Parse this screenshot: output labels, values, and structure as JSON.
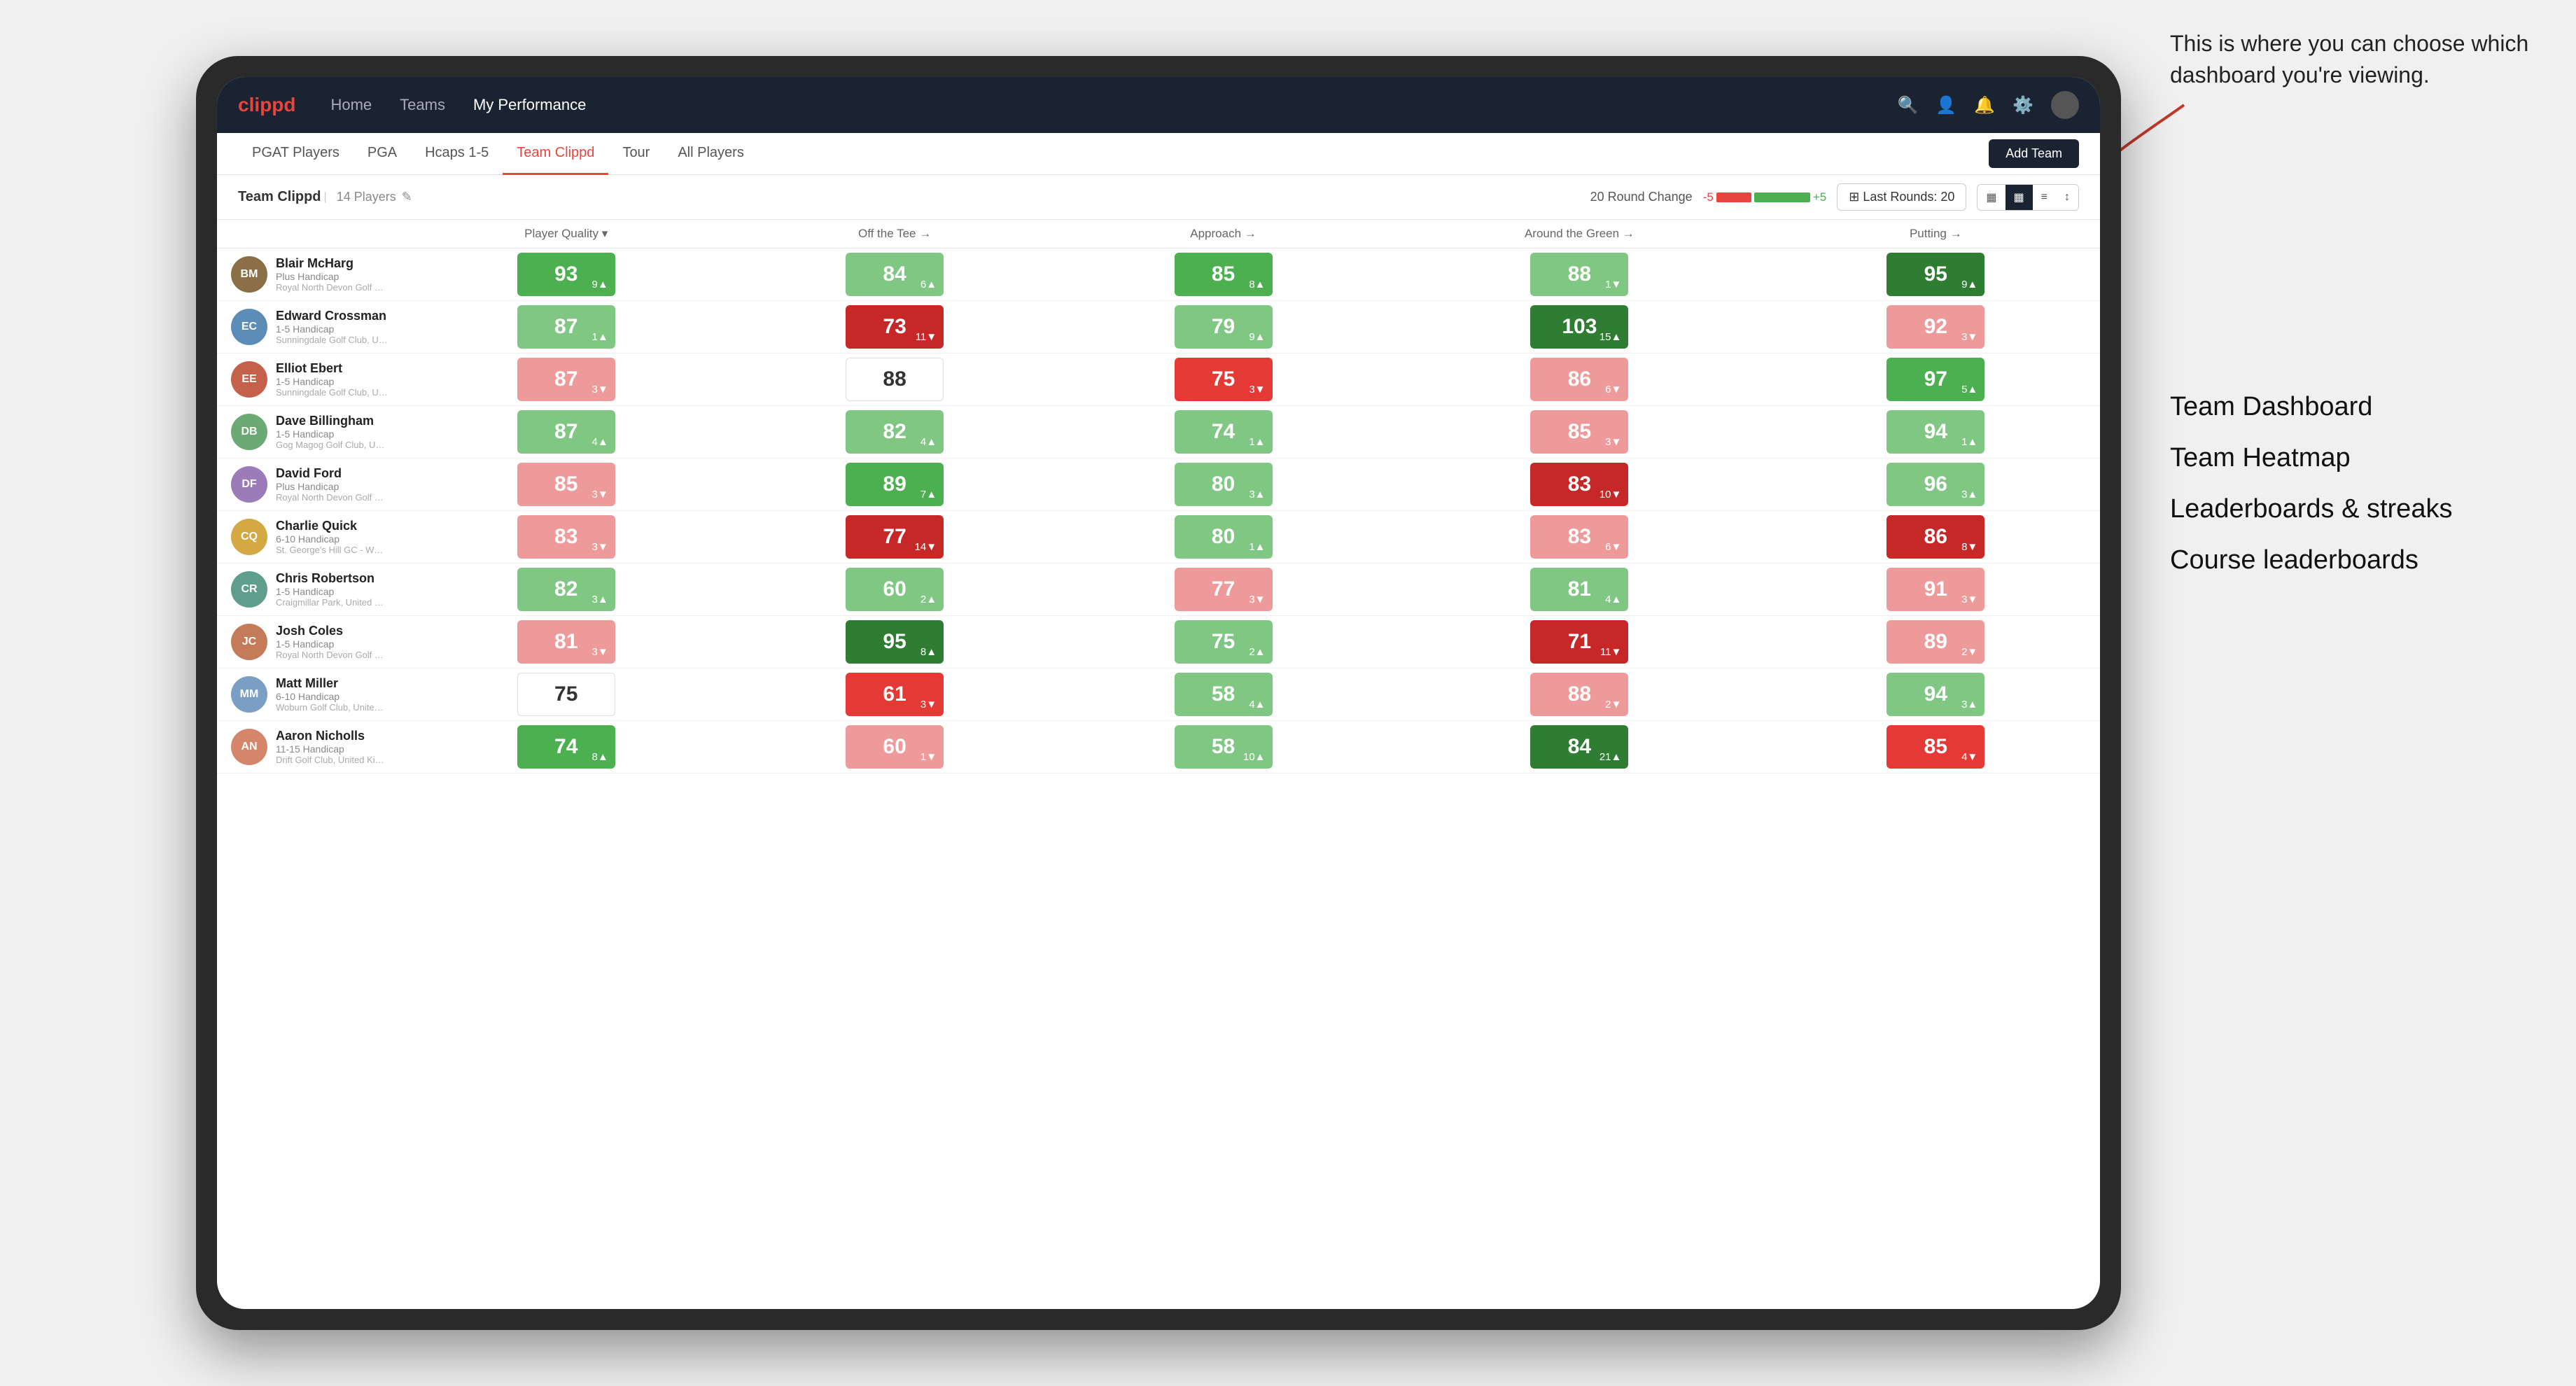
{
  "annotation": {
    "intro": "This is where you can choose which dashboard you're viewing.",
    "items": [
      "Team Dashboard",
      "Team Heatmap",
      "Leaderboards & streaks",
      "Course leaderboards"
    ]
  },
  "nav": {
    "logo": "clippd",
    "items": [
      "Home",
      "Teams",
      "My Performance"
    ],
    "active": "My Performance"
  },
  "subnav": {
    "items": [
      "PGAT Players",
      "PGA",
      "Hcaps 1-5",
      "Team Clippd",
      "Tour",
      "All Players"
    ],
    "active": "Team Clippd",
    "add_button": "Add Team"
  },
  "teambar": {
    "team_name": "Team Clippd",
    "player_count": "14 Players",
    "round_change_label": "20 Round Change",
    "neg_label": "-5",
    "pos_label": "+5",
    "last_rounds_label": "Last Rounds: 20"
  },
  "table": {
    "headers": [
      "Player Quality ↓",
      "Off the Tee →",
      "Approach →",
      "Around the Green →",
      "Putting →"
    ],
    "players": [
      {
        "name": "Blair McHarg",
        "handicap": "Plus Handicap",
        "club": "Royal North Devon Golf Club, United Kingdom",
        "scores": [
          {
            "val": "93",
            "delta": "9",
            "dir": "up",
            "color": "green-med"
          },
          {
            "val": "84",
            "delta": "6",
            "dir": "up",
            "color": "green-light"
          },
          {
            "val": "85",
            "delta": "8",
            "dir": "up",
            "color": "green-med"
          },
          {
            "val": "88",
            "delta": "1",
            "dir": "down",
            "color": "green-light"
          },
          {
            "val": "95",
            "delta": "9",
            "dir": "up",
            "color": "green-dark"
          }
        ]
      },
      {
        "name": "Edward Crossman",
        "handicap": "1-5 Handicap",
        "club": "Sunningdale Golf Club, United Kingdom",
        "scores": [
          {
            "val": "87",
            "delta": "1",
            "dir": "up",
            "color": "green-light"
          },
          {
            "val": "73",
            "delta": "11",
            "dir": "down",
            "color": "red-dark"
          },
          {
            "val": "79",
            "delta": "9",
            "dir": "up",
            "color": "green-light"
          },
          {
            "val": "103",
            "delta": "15",
            "dir": "up",
            "color": "green-dark"
          },
          {
            "val": "92",
            "delta": "3",
            "dir": "down",
            "color": "red-light"
          }
        ]
      },
      {
        "name": "Elliot Ebert",
        "handicap": "1-5 Handicap",
        "club": "Sunningdale Golf Club, United Kingdom",
        "scores": [
          {
            "val": "87",
            "delta": "3",
            "dir": "down",
            "color": "red-light"
          },
          {
            "val": "88",
            "delta": "",
            "dir": "",
            "color": "white-bg"
          },
          {
            "val": "75",
            "delta": "3",
            "dir": "down",
            "color": "red-med"
          },
          {
            "val": "86",
            "delta": "6",
            "dir": "down",
            "color": "red-light"
          },
          {
            "val": "97",
            "delta": "5",
            "dir": "up",
            "color": "green-med"
          }
        ]
      },
      {
        "name": "Dave Billingham",
        "handicap": "1-5 Handicap",
        "club": "Gog Magog Golf Club, United Kingdom",
        "scores": [
          {
            "val": "87",
            "delta": "4",
            "dir": "up",
            "color": "green-light"
          },
          {
            "val": "82",
            "delta": "4",
            "dir": "up",
            "color": "green-light"
          },
          {
            "val": "74",
            "delta": "1",
            "dir": "up",
            "color": "green-light"
          },
          {
            "val": "85",
            "delta": "3",
            "dir": "down",
            "color": "red-light"
          },
          {
            "val": "94",
            "delta": "1",
            "dir": "up",
            "color": "green-light"
          }
        ]
      },
      {
        "name": "David Ford",
        "handicap": "Plus Handicap",
        "club": "Royal North Devon Golf Club, United Kingdom",
        "scores": [
          {
            "val": "85",
            "delta": "3",
            "dir": "down",
            "color": "red-light"
          },
          {
            "val": "89",
            "delta": "7",
            "dir": "up",
            "color": "green-med"
          },
          {
            "val": "80",
            "delta": "3",
            "dir": "up",
            "color": "green-light"
          },
          {
            "val": "83",
            "delta": "10",
            "dir": "down",
            "color": "red-dark"
          },
          {
            "val": "96",
            "delta": "3",
            "dir": "up",
            "color": "green-light"
          }
        ]
      },
      {
        "name": "Charlie Quick",
        "handicap": "6-10 Handicap",
        "club": "St. George's Hill GC - Weybridge - Surrey, Uni...",
        "scores": [
          {
            "val": "83",
            "delta": "3",
            "dir": "down",
            "color": "red-light"
          },
          {
            "val": "77",
            "delta": "14",
            "dir": "down",
            "color": "red-dark"
          },
          {
            "val": "80",
            "delta": "1",
            "dir": "up",
            "color": "green-light"
          },
          {
            "val": "83",
            "delta": "6",
            "dir": "down",
            "color": "red-light"
          },
          {
            "val": "86",
            "delta": "8",
            "dir": "down",
            "color": "red-dark"
          }
        ]
      },
      {
        "name": "Chris Robertson",
        "handicap": "1-5 Handicap",
        "club": "Craigmillar Park, United Kingdom",
        "scores": [
          {
            "val": "82",
            "delta": "3",
            "dir": "up",
            "color": "green-light"
          },
          {
            "val": "60",
            "delta": "2",
            "dir": "up",
            "color": "green-light"
          },
          {
            "val": "77",
            "delta": "3",
            "dir": "down",
            "color": "red-light"
          },
          {
            "val": "81",
            "delta": "4",
            "dir": "up",
            "color": "green-light"
          },
          {
            "val": "91",
            "delta": "3",
            "dir": "down",
            "color": "red-light"
          }
        ]
      },
      {
        "name": "Josh Coles",
        "handicap": "1-5 Handicap",
        "club": "Royal North Devon Golf Club, United Kingdom",
        "scores": [
          {
            "val": "81",
            "delta": "3",
            "dir": "down",
            "color": "red-light"
          },
          {
            "val": "95",
            "delta": "8",
            "dir": "up",
            "color": "green-dark"
          },
          {
            "val": "75",
            "delta": "2",
            "dir": "up",
            "color": "green-light"
          },
          {
            "val": "71",
            "delta": "11",
            "dir": "down",
            "color": "red-dark"
          },
          {
            "val": "89",
            "delta": "2",
            "dir": "down",
            "color": "red-light"
          }
        ]
      },
      {
        "name": "Matt Miller",
        "handicap": "6-10 Handicap",
        "club": "Woburn Golf Club, United Kingdom",
        "scores": [
          {
            "val": "75",
            "delta": "",
            "dir": "",
            "color": "white-bg"
          },
          {
            "val": "61",
            "delta": "3",
            "dir": "down",
            "color": "red-med"
          },
          {
            "val": "58",
            "delta": "4",
            "dir": "up",
            "color": "green-light"
          },
          {
            "val": "88",
            "delta": "2",
            "dir": "down",
            "color": "red-light"
          },
          {
            "val": "94",
            "delta": "3",
            "dir": "up",
            "color": "green-light"
          }
        ]
      },
      {
        "name": "Aaron Nicholls",
        "handicap": "11-15 Handicap",
        "club": "Drift Golf Club, United Kingdom",
        "scores": [
          {
            "val": "74",
            "delta": "8",
            "dir": "up",
            "color": "green-med"
          },
          {
            "val": "60",
            "delta": "1",
            "dir": "down",
            "color": "red-light"
          },
          {
            "val": "58",
            "delta": "10",
            "dir": "up",
            "color": "green-light"
          },
          {
            "val": "84",
            "delta": "21",
            "dir": "up",
            "color": "green-dark"
          },
          {
            "val": "85",
            "delta": "4",
            "dir": "down",
            "color": "red-med"
          }
        ]
      }
    ]
  },
  "icons": {
    "search": "🔍",
    "user": "👤",
    "bell": "🔔",
    "settings": "⚙",
    "grid": "▦",
    "list": "≡",
    "filter": "⊞",
    "edit": "✎",
    "caret_down": "▾",
    "caret_up": "▴"
  }
}
